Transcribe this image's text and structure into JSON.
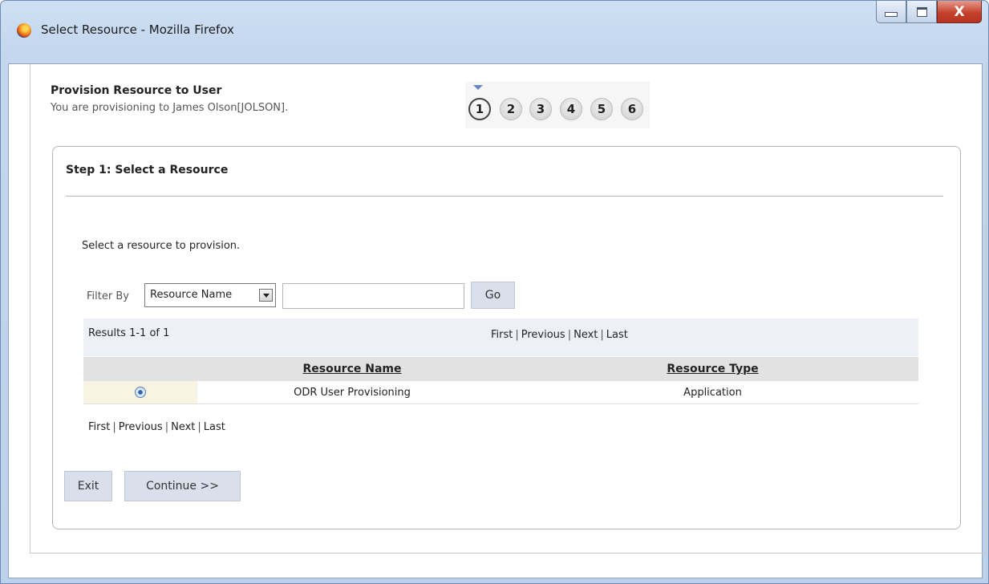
{
  "window": {
    "title": "Select Resource - Mozilla Firefox",
    "close_glyph": "X"
  },
  "header": {
    "title": "Provision Resource to User",
    "subtitle": "You are provisioning to James Olson[JOLSON]."
  },
  "steps": {
    "items": [
      "1",
      "2",
      "3",
      "4",
      "5",
      "6"
    ],
    "active": "1"
  },
  "step_panel": {
    "title": "Step 1: Select a Resource",
    "instruction": "Select a resource to provision."
  },
  "filter": {
    "label": "Filter By",
    "selected_option": "Resource Name",
    "input_value": "",
    "go_label": "Go"
  },
  "results": {
    "count_text": "Results 1-1 of 1",
    "pager": {
      "first": "First",
      "previous": "Previous",
      "next": "Next",
      "last": "Last",
      "separator": "|"
    },
    "columns": [
      "Resource Name",
      "Resource Type"
    ],
    "rows": [
      {
        "name": "ODR User Provisioning",
        "type": "Application",
        "selected": true
      }
    ]
  },
  "actions": {
    "exit_label": "Exit",
    "continue_label": "Continue >>"
  },
  "colors": {
    "button_bg": "#d9dfeb",
    "results_bar_bg": "#edf1f7",
    "header_row_bg": "#e2e2e2",
    "selected_cell_bg": "#f7f4e3",
    "window_frame": "#c3d7ee",
    "close_button": "#c4422d"
  }
}
